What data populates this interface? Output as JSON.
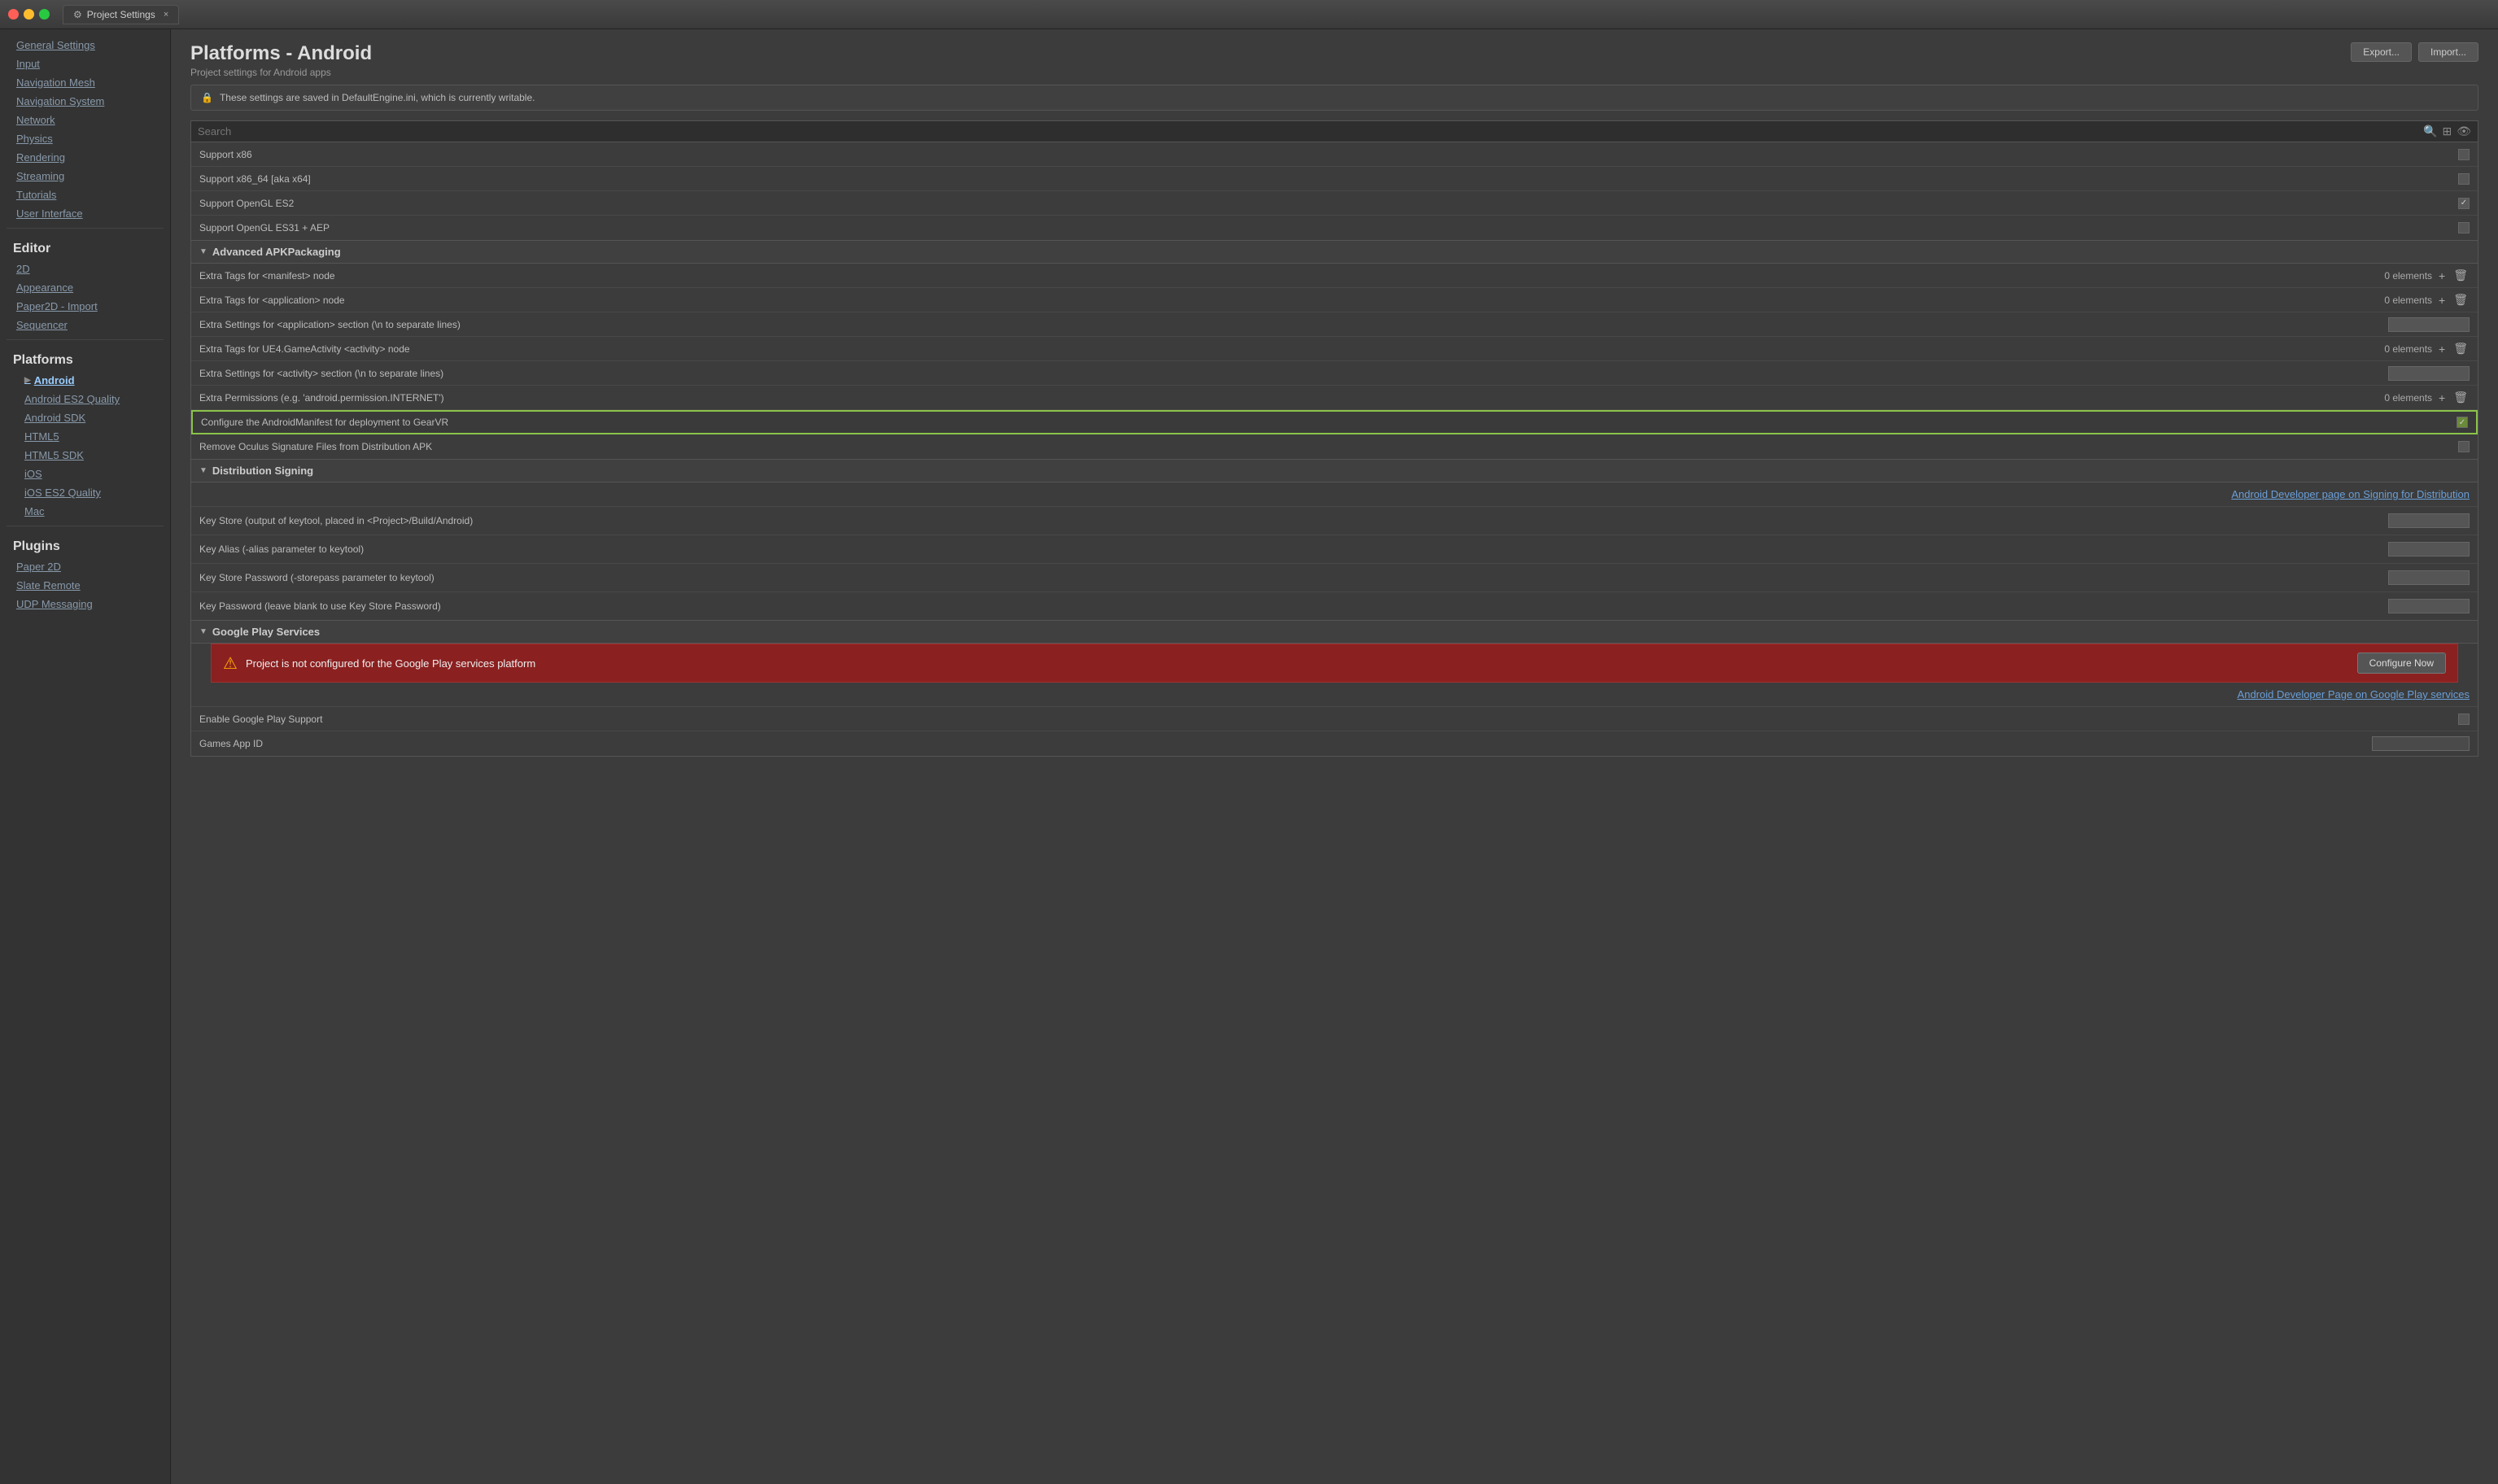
{
  "titlebar": {
    "tab_label": "Project Settings",
    "tab_close": "×"
  },
  "header": {
    "title": "Platforms - Android",
    "subtitle": "Project settings for Android apps",
    "export_btn": "Export...",
    "import_btn": "Import..."
  },
  "notice": {
    "text": "These settings are saved in DefaultEngine.ini, which is currently writable."
  },
  "search": {
    "placeholder": "Search"
  },
  "sidebar": {
    "project_items": [
      {
        "label": "General Settings",
        "id": "general-settings"
      },
      {
        "label": "Input",
        "id": "input"
      },
      {
        "label": "Navigation Mesh",
        "id": "navigation-mesh"
      },
      {
        "label": "Navigation System",
        "id": "navigation-system"
      },
      {
        "label": "Network",
        "id": "network"
      },
      {
        "label": "Physics",
        "id": "physics"
      },
      {
        "label": "Rendering",
        "id": "rendering"
      },
      {
        "label": "Streaming",
        "id": "streaming"
      },
      {
        "label": "Tutorials",
        "id": "tutorials"
      },
      {
        "label": "User Interface",
        "id": "user-interface"
      }
    ],
    "editor_label": "Editor",
    "editor_items": [
      {
        "label": "2D",
        "id": "2d"
      },
      {
        "label": "Appearance",
        "id": "appearance"
      },
      {
        "label": "Paper2D - Import",
        "id": "paper2d-import"
      },
      {
        "label": "Sequencer",
        "id": "sequencer"
      }
    ],
    "platforms_label": "Platforms",
    "platforms_items": [
      {
        "label": "Android",
        "id": "android",
        "expanded": true
      },
      {
        "label": "Android ES2 Quality",
        "id": "android-es2-quality"
      },
      {
        "label": "Android SDK",
        "id": "android-sdk"
      },
      {
        "label": "HTML5",
        "id": "html5"
      },
      {
        "label": "HTML5 SDK",
        "id": "html5-sdk"
      },
      {
        "label": "iOS",
        "id": "ios"
      },
      {
        "label": "iOS ES2 Quality",
        "id": "ios-es2-quality"
      },
      {
        "label": "Mac",
        "id": "mac"
      }
    ],
    "plugins_label": "Plugins",
    "plugins_items": [
      {
        "label": "Paper 2D",
        "id": "paper-2d"
      },
      {
        "label": "Slate Remote",
        "id": "slate-remote"
      },
      {
        "label": "UDP Messaging",
        "id": "udp-messaging"
      }
    ]
  },
  "support_section": {
    "rows": [
      {
        "label": "Support x86",
        "checked": false,
        "type": "checkbox"
      },
      {
        "label": "Support x86_64 [aka x64]",
        "checked": false,
        "type": "checkbox"
      },
      {
        "label": "Support OpenGL ES2",
        "checked": true,
        "type": "checkbox"
      },
      {
        "label": "Support OpenGL ES31 + AEP",
        "checked": false,
        "type": "checkbox"
      }
    ]
  },
  "apk_section": {
    "title": "Advanced APKPackaging",
    "rows": [
      {
        "label": "Extra Tags for <manifest> node",
        "type": "count",
        "count": "0 elements"
      },
      {
        "label": "Extra Tags for <application> node",
        "type": "count",
        "count": "0 elements"
      },
      {
        "label": "Extra Settings for <application> section (\\n to separate lines)",
        "type": "textinput"
      },
      {
        "label": "Extra Tags for UE4.GameActivity <activity> node",
        "type": "count",
        "count": "0 elements"
      },
      {
        "label": "Extra Settings for <activity> section (\\n to separate lines)",
        "type": "textinput"
      },
      {
        "label": "Extra Permissions (e.g. 'android.permission.INTERNET')",
        "type": "count",
        "count": "0 elements"
      },
      {
        "label": "Configure the AndroidManifest for deployment to GearVR",
        "type": "checkbox-highlighted",
        "checked": true
      },
      {
        "label": "Remove Oculus Signature Files from Distribution APK",
        "type": "checkbox",
        "checked": false
      }
    ]
  },
  "dist_section": {
    "title": "Distribution Signing",
    "link_text": "Android Developer page on Signing for Distribution",
    "rows": [
      {
        "label": "Key Store (output of keytool, placed in <Project>/Build/Android)",
        "type": "textinput"
      },
      {
        "label": "Key Alias (-alias parameter to keytool)",
        "type": "textinput"
      },
      {
        "label": "Key Store Password (-storepass parameter to keytool)",
        "type": "textinput"
      },
      {
        "label": "Key Password (leave blank to use Key Store Password)",
        "type": "textinput"
      }
    ]
  },
  "gps_section": {
    "title": "Google Play Services",
    "error_text": "Project is not configured for the Google Play services platform",
    "configure_btn": "Configure Now",
    "link_text": "Android Developer Page on Google Play services",
    "rows": [
      {
        "label": "Enable Google Play Support",
        "type": "checkbox",
        "checked": false
      },
      {
        "label": "Games App ID",
        "type": "textinput"
      }
    ]
  },
  "icons": {
    "gear": "⚙",
    "lock": "🔒",
    "search": "🔍",
    "grid": "⊞",
    "eye": "👁",
    "arrow_right": "▶",
    "arrow_down": "▼",
    "plus": "+",
    "trash": "🗑",
    "warning": "⚠"
  }
}
